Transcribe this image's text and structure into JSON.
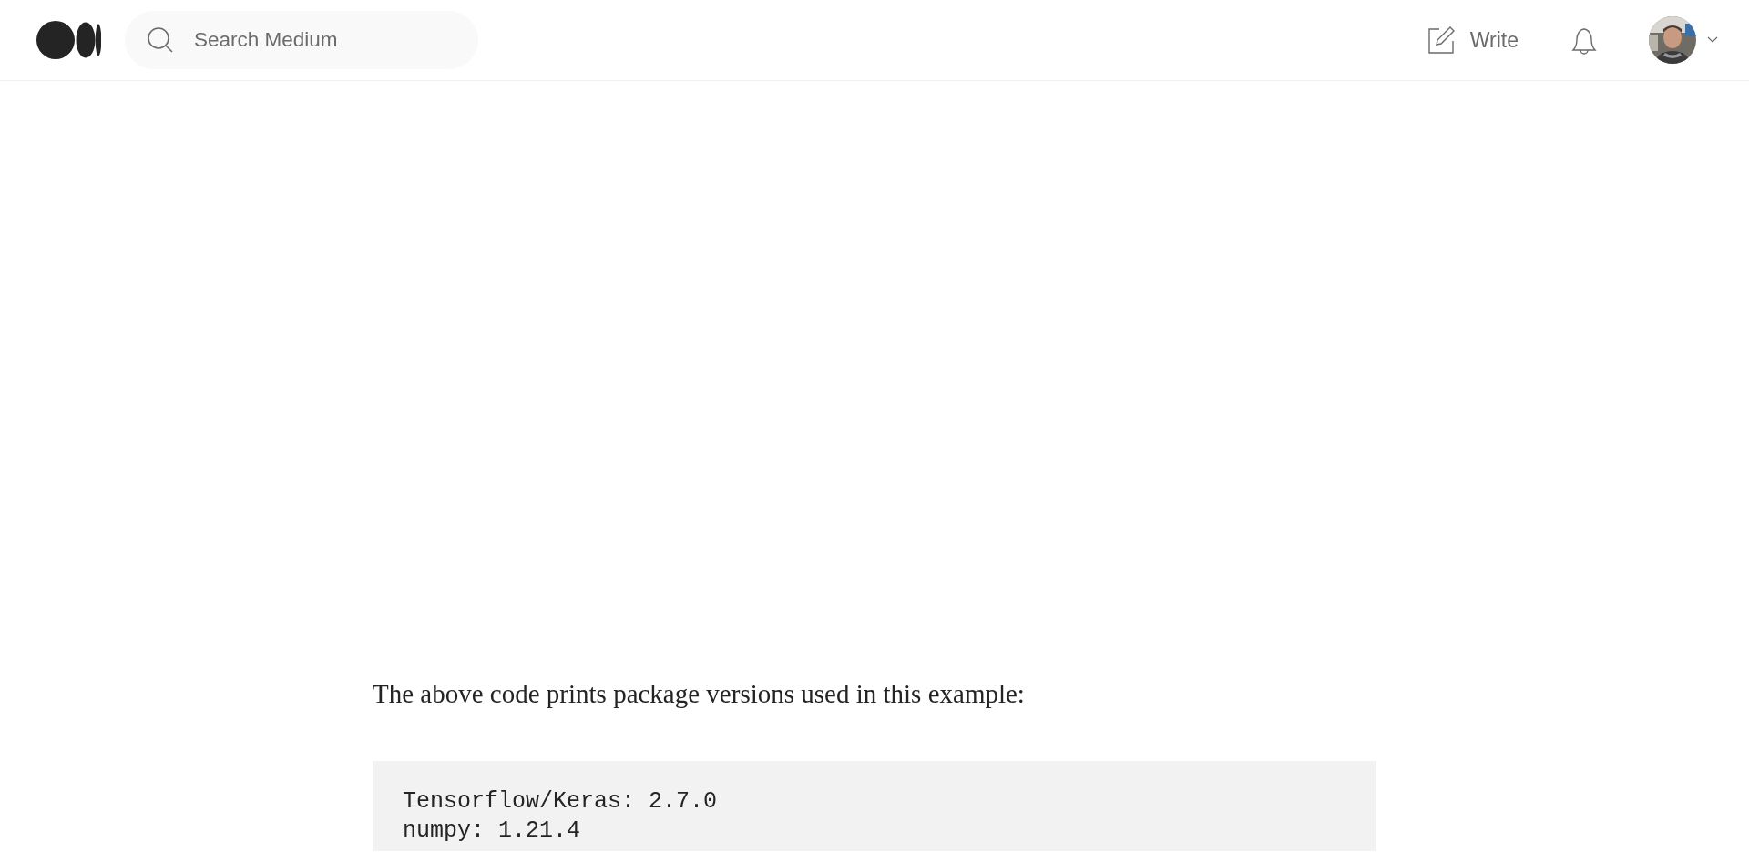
{
  "header": {
    "search": {
      "placeholder": "Search Medium"
    },
    "write_label": "Write"
  },
  "article": {
    "paragraph": "The above code prints package versions used in this example:",
    "code_lines": [
      "Tensorflow/Keras: 2.7.0",
      "numpy: 1.21.4"
    ]
  }
}
